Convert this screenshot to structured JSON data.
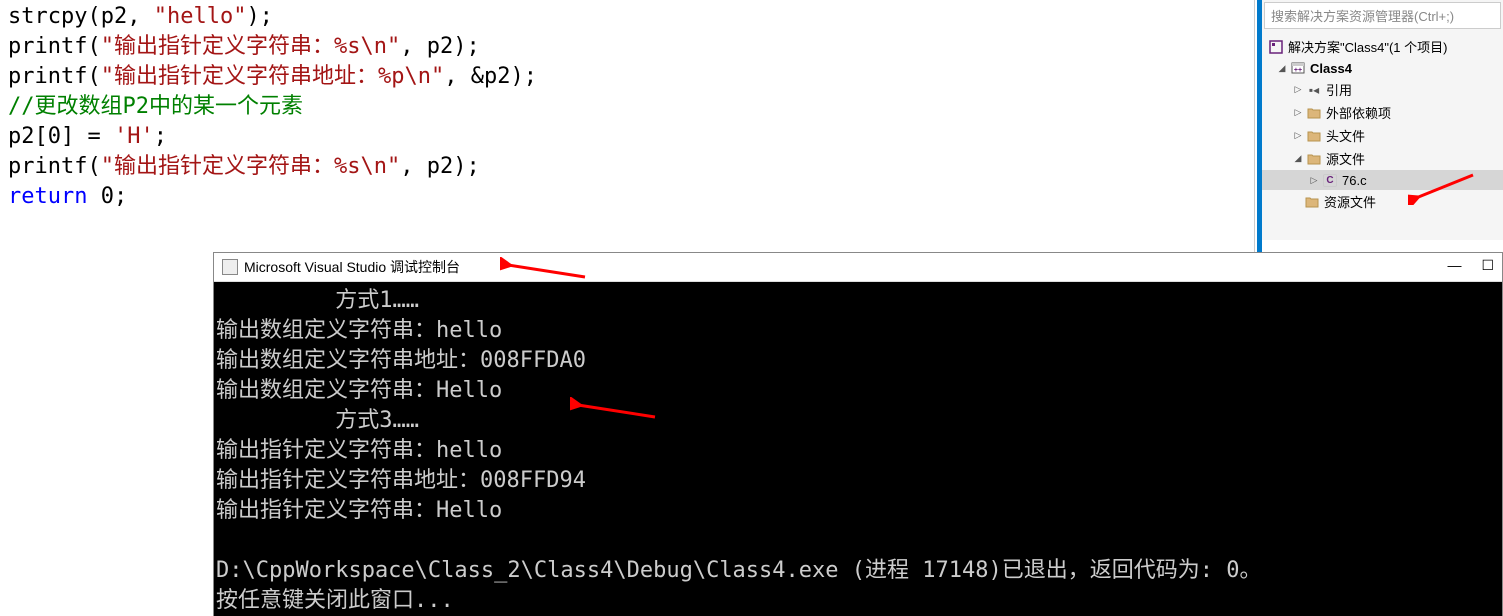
{
  "code": {
    "line1_func": "strcpy",
    "line1_args_a": "(p2, ",
    "line1_str": "\"hello\"",
    "line1_args_b": ");",
    "line2_func": "printf",
    "line2_a": "(",
    "line2_str": "\"输出指针定义字符串：%s\\n\"",
    "line2_b": ", p2);",
    "line3_func": "printf",
    "line3_a": "(",
    "line3_str": "\"输出指针定义字符串地址：%p\\n\"",
    "line3_b": ", &p2);",
    "line4_comment": "//更改数组P2中的某一个元素",
    "line5_a": "p2[",
    "line5_idx": "0",
    "line5_b": "] = ",
    "line5_char": "'H'",
    "line5_c": ";",
    "line6_func": "printf",
    "line6_a": "(",
    "line6_str": "\"输出指针定义字符串：%s\\n\"",
    "line6_b": ", p2);",
    "line7_kw": "return",
    "line7_a": " ",
    "line7_val": "0",
    "line7_b": ";"
  },
  "explorer": {
    "search_placeholder": "搜索解决方案资源管理器(Ctrl+;)",
    "solution_label": "解决方案\"Class4\"(1 个项目)",
    "project_label": "Class4",
    "refs_label": "引用",
    "external_label": "外部依赖项",
    "headers_label": "头文件",
    "sources_label": "源文件",
    "file_label": "76.c",
    "resources_label": "资源文件"
  },
  "console": {
    "title": "Microsoft Visual Studio 调试控制台",
    "lines": [
      "         方式1……",
      "输出数组定义字符串：hello",
      "输出数组定义字符串地址：008FFDA0",
      "输出数组定义字符串：Hello",
      "         方式3……",
      "输出指针定义字符串：hello",
      "输出指针定义字符串地址：008FFD94",
      "输出指针定义字符串：Hello",
      "",
      "D:\\CppWorkspace\\Class_2\\Class4\\Debug\\Class4.exe (进程 17148)已退出，返回代码为: 0。",
      "按任意键关闭此窗口..."
    ],
    "minimize": "—",
    "maximize": "☐"
  }
}
